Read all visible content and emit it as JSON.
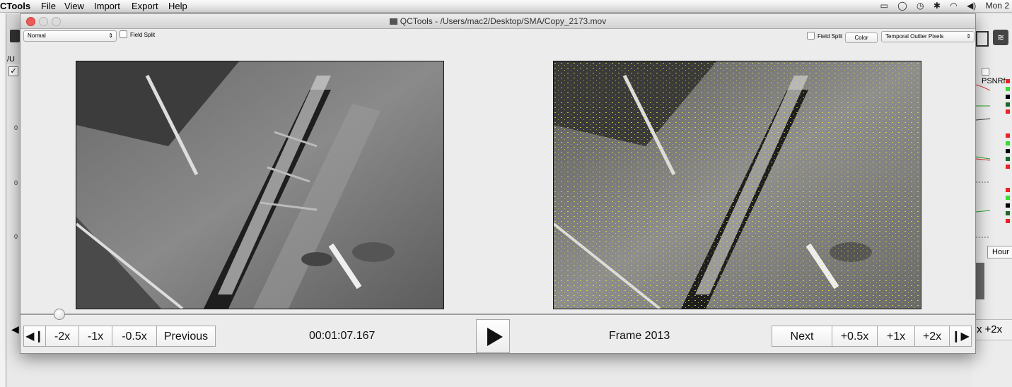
{
  "menubar": {
    "app_name": "CTools",
    "items": [
      "File",
      "View",
      "Import",
      "Export",
      "Help"
    ],
    "clock": "Mon 2"
  },
  "background_window": {
    "path_fragment": "/U",
    "graph_ticks": [
      "0",
      "0",
      "0"
    ],
    "psnr_label": "PSNRf",
    "hour_button": "Hour",
    "plus2_label": "+2x",
    "x_label": "x"
  },
  "player": {
    "title": "QCTools - /Users/mac2/Desktop/SMA/Copy_2173.mov",
    "left_mode": "Normal",
    "left_field_split": "Field Split",
    "right_field_split": "Field Split",
    "color_button": "Color",
    "right_mode": "Temporal Outlier Pixels",
    "controls": {
      "prev_frame_icon": "◀❙",
      "minus2": "-2x",
      "minus1": "-1x",
      "minus05": "-0.5x",
      "previous": "Previous",
      "timecode": "00:01:07.167",
      "frame": "Frame 2013",
      "next": "Next",
      "plus05": "+0.5x",
      "plus1": "+1x",
      "plus2": "+2x",
      "next_frame_icon": "❙▶"
    },
    "position_fraction": 0.04
  }
}
